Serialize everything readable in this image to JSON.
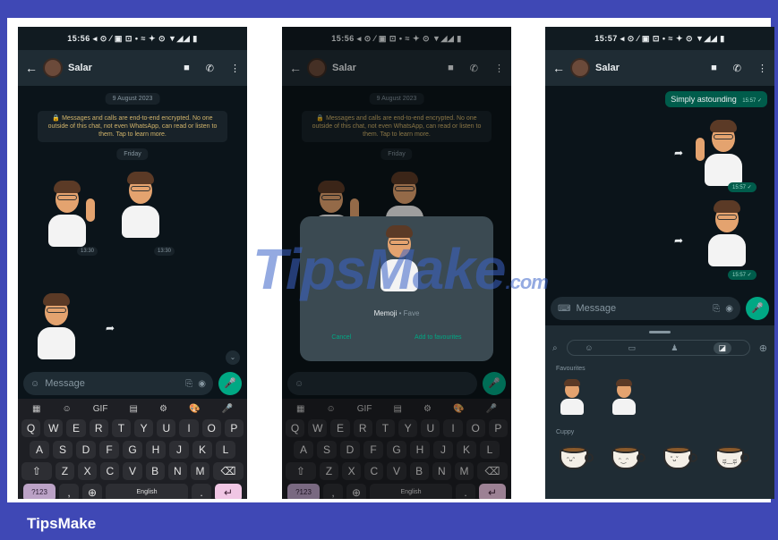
{
  "site": {
    "brand": "TipsMake",
    "watermark": "TipsMake",
    "watermark_suffix": ".com"
  },
  "colors": {
    "frame": "#3f48b5",
    "chat_bg": "#0b141a",
    "header_bg": "#1f2c34",
    "accent": "#00a884",
    "bubble_out": "#005c4b"
  },
  "phone1": {
    "status": "15:56 ◂ ⊙ ⁄ ▣ ⊡ •   ≈ ✦ ⊙ ▼◢◢ ▮",
    "contact": "Salar",
    "date": "9 August 2023",
    "encryption": "🔒 Messages and calls are end-to-end encrypted. No one outside of this chat, not even WhatsApp, can read or listen to them. Tap to learn more.",
    "day": "Friday",
    "times": [
      "13:30",
      "13:30"
    ],
    "composer_placeholder": "Message",
    "keyboard": {
      "tools": [
        "▦",
        "☺",
        "GIF",
        "▤",
        "⚙",
        "🎨",
        "🎤"
      ],
      "row1": [
        "Q",
        "W",
        "E",
        "R",
        "T",
        "Y",
        "U",
        "I",
        "O",
        "P"
      ],
      "row2": [
        "A",
        "S",
        "D",
        "F",
        "G",
        "H",
        "J",
        "K",
        "L"
      ],
      "row3": [
        "Z",
        "X",
        "C",
        "V",
        "B",
        "N",
        "M"
      ],
      "numbers_key": "?123",
      "space_label": "English"
    }
  },
  "phone2": {
    "status": "15:56 ◂ ⊙ ⁄ ▣ ⊡ •   ≈ ✦ ⊙ ▼◢◢ ▮",
    "contact": "Salar",
    "date": "9 August 2023",
    "encryption": "🔒 Messages and calls are end-to-end encrypted. No one outside of this chat, not even WhatsApp, can read or listen to them. Tap to learn more.",
    "day": "Friday",
    "popup": {
      "caption": "Memoji",
      "caption_extra": "• Fave",
      "cancel": "Cancel",
      "add": "Add to favourites"
    },
    "space_label": "English",
    "numbers_key": "?123"
  },
  "phone3": {
    "status": "15:57 ◂ ⊙ ⁄ ▣ ⊡ •   ≈ ✦ ⊙ ▼◢◢ ▮",
    "contact": "Salar",
    "bubble_text": "Simply astounding",
    "bubble_time": "15:57 ✓",
    "times": [
      "15:57 ✓",
      "15:57 ✓"
    ],
    "composer_placeholder": "Message",
    "sections": {
      "favourites": "Favourites",
      "cuppy": "Cuppy"
    }
  }
}
